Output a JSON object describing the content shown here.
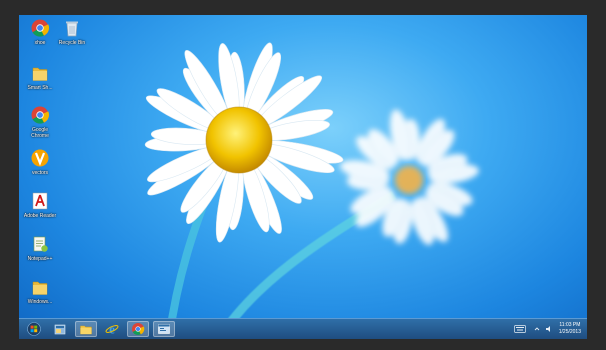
{
  "desktop": {
    "icons": [
      {
        "name": "chrome-app-icon",
        "label": "xhoe",
        "icon": "chrome-icon"
      },
      {
        "name": "recycle-bin-icon",
        "label": "Recycle Bin",
        "icon": "recycle-bin-icon"
      },
      {
        "name": "folder-icon-1",
        "label": "Smart Sh...",
        "icon": "folder-icon"
      },
      {
        "name": "google-chrome-icon",
        "label": "Google Chrome",
        "icon": "chrome-icon"
      },
      {
        "name": "vectors-icon",
        "label": "vectors",
        "icon": "v-app-icon"
      },
      {
        "name": "adobe-reader-icon",
        "label": "Adobe Reader",
        "icon": "adobe-icon"
      },
      {
        "name": "notepad-icon",
        "label": "Notepad++",
        "icon": "notepad-icon"
      },
      {
        "name": "folder-icon-2",
        "label": "Windows...",
        "icon": "folder-icon"
      }
    ]
  },
  "taskbar": {
    "buttons": [
      {
        "name": "start-button",
        "icon": "windows-logo-icon",
        "active": false
      },
      {
        "name": "taskbar-explorer-icon",
        "icon": "explorer-icon",
        "active": false
      },
      {
        "name": "taskbar-folder-icon",
        "icon": "folder-icon",
        "active": true
      },
      {
        "name": "taskbar-ie-icon",
        "icon": "internet-explorer-icon",
        "active": false
      },
      {
        "name": "taskbar-chrome-icon",
        "icon": "chrome-icon",
        "active": true
      },
      {
        "name": "taskbar-window-icon",
        "icon": "window-icon",
        "active": true
      }
    ],
    "tray": {
      "time": "11:03 PM",
      "date": "1/25/2013"
    }
  },
  "colors": {
    "wallpaper_blue": "#2d9ae8",
    "taskbar": "#245b91",
    "flower_center": "#f2c200"
  }
}
